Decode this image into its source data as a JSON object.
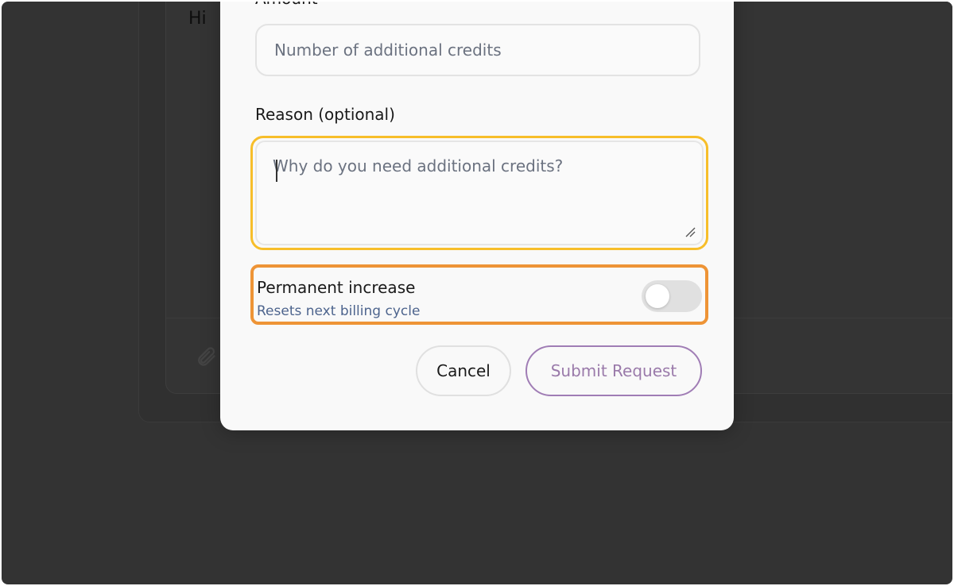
{
  "background": {
    "greeting": "Hi",
    "attach_icon": "paperclip-icon"
  },
  "modal": {
    "amount_label": "Amount",
    "amount_placeholder": "Number of additional credits",
    "reason_label": "Reason (optional)",
    "reason_placeholder": "Why do you need additional credits?",
    "permanent_title": "Permanent increase",
    "permanent_subtitle": "Resets next billing cycle",
    "permanent_enabled": false,
    "cancel_label": "Cancel",
    "submit_label": "Submit Request"
  },
  "colors": {
    "focus_ring": "#f7be2a",
    "highlight": "#ee9436",
    "submit_accent": "#a07db5",
    "subtitle": "#4d648d",
    "backdrop": "#333333"
  }
}
